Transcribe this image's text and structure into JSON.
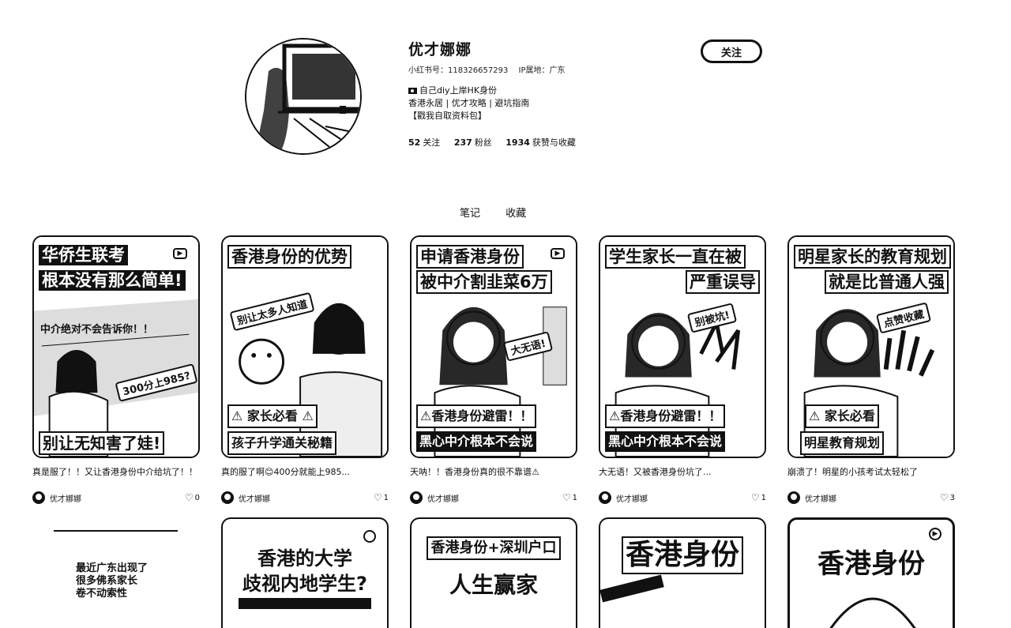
{
  "profile": {
    "name": "优才娜娜",
    "id_label": "小红书号：118326657293",
    "ip_label": "IP属地：广东",
    "bio": [
      "自己diy上岸HK身份",
      "香港永居 | 优才攻略 | 避坑指南",
      "【戳我自取资料包】"
    ],
    "stats": [
      {
        "num": "52",
        "label": "关注"
      },
      {
        "num": "237",
        "label": "粉丝"
      },
      {
        "num": "1934",
        "label": "获赞与收藏"
      }
    ],
    "follow_label": "关注"
  },
  "tabs": [
    "笔记",
    "收藏"
  ],
  "notes": [
    {
      "cover_t1": "华侨生联考",
      "cover_t2": "根本没有那么简单!",
      "cover_mid": "中介绝对不会告诉你！！",
      "cover_sticker": "300分上985?",
      "cover_b1": "",
      "cover_b2": "别让无知害了娃!",
      "title": "真是服了！！又让香港身份中介给坑了！！",
      "author": "优才娜娜",
      "likes": "0"
    },
    {
      "cover_t1": "香港身份的优势",
      "cover_t2": "",
      "cover_mid": "",
      "cover_sticker": "别让太多人知道",
      "cover_b1": "⚠ 家长必看 ⚠",
      "cover_b2": "孩子升学通关秘籍",
      "title": "真的服了啊😊400分就能上985...",
      "author": "优才娜娜",
      "likes": "1"
    },
    {
      "cover_t1": "申请香港身份",
      "cover_t2": "被中介割韭菜6万",
      "cover_mid": "",
      "cover_sticker": "大无语!",
      "cover_b1": "⚠香港身份避雷！！",
      "cover_b2": "黑心中介根本不会说",
      "title": "天呐！！香港身份真的很不靠谱⚠",
      "author": "优才娜娜",
      "likes": "1"
    },
    {
      "cover_t1": "学生家长一直在被",
      "cover_t2": "严重误导",
      "cover_mid": "",
      "cover_sticker": "别被坑!",
      "cover_b1": "⚠香港身份避雷！！",
      "cover_b2": "黑心中介根本不会说",
      "title": "大无语！又被香港身份坑了...",
      "author": "优才娜娜",
      "likes": "1"
    },
    {
      "cover_t1": "明星家长的教育规划",
      "cover_t2": "就是比普通人强",
      "cover_mid": "",
      "cover_sticker": "点赞收藏",
      "cover_b1": "⚠ 家长必看",
      "cover_b2": "明星教育规划",
      "title": "崩溃了！明星的小孩考试太轻松了",
      "author": "优才娜娜",
      "likes": "3"
    }
  ],
  "row2": [
    {
      "t1": "香港的大学",
      "t2": "歧视内地学生?"
    },
    {
      "t1": "香港身份+深圳户口",
      "t2": "人生赢家"
    },
    {
      "t1": "香港身份",
      "t2": ""
    },
    {
      "t1": "香港身份",
      "t2": ""
    }
  ],
  "promo": [
    "最近广东出现了",
    "很多佛系家长",
    "卷不动索性"
  ]
}
